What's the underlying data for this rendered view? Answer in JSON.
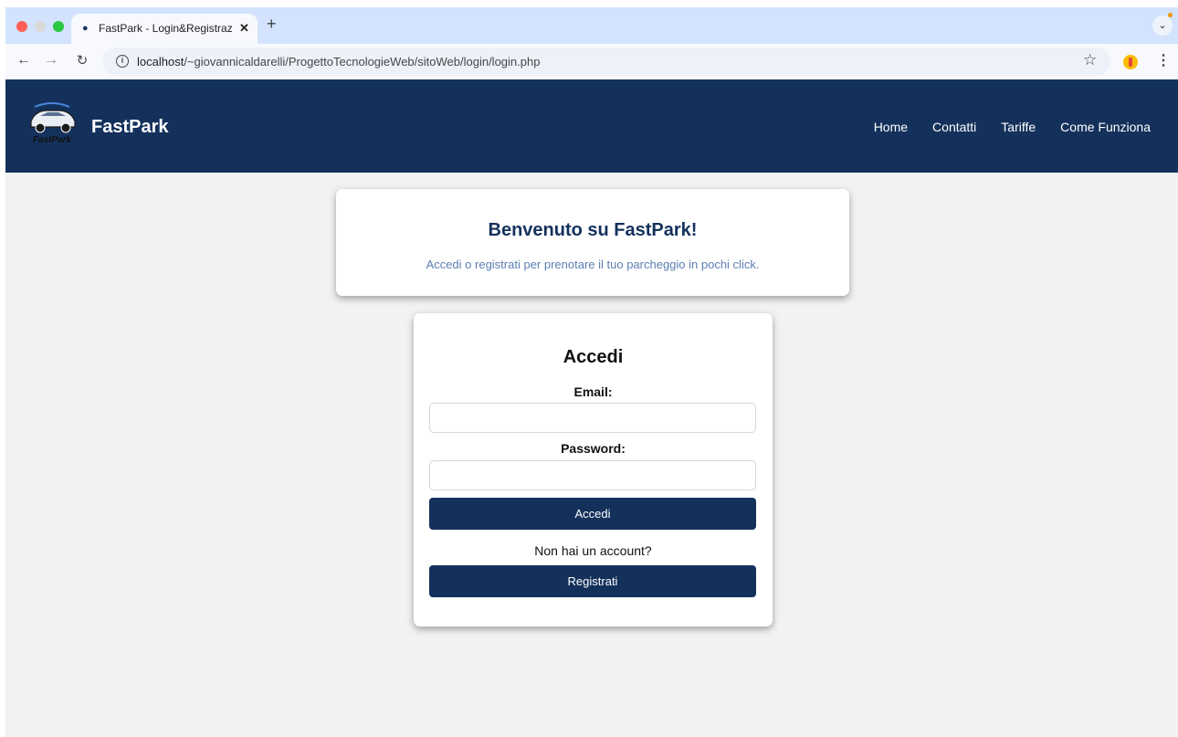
{
  "browser": {
    "tab_title": "FastPark - Login&Registrazione",
    "tab_close": "✕",
    "new_tab": "+",
    "tab_menu": "⌄",
    "url_host": "localhost",
    "url_path": "/~giovannicaldarelli/ProgettoTecnologieWeb/sitoWeb/login/login.php",
    "icons": [
      "back-arrow-icon",
      "forward-arrow-icon",
      "reload-icon",
      "site-info-icon",
      "bookmark-star-icon",
      "extension-icon",
      "kebab-menu-icon"
    ]
  },
  "header": {
    "brand": "FastPark",
    "logo_text": "FastPark",
    "nav": [
      "Home",
      "Contatti",
      "Tariffe",
      "Come Funziona"
    ],
    "background_color": "#14315c"
  },
  "welcome": {
    "title": "Benvenuto su FastPark!",
    "subtitle": "Accedi o registrati per prenotare il tuo parcheggio in pochi click."
  },
  "login": {
    "title": "Accedi",
    "email_label": "Email:",
    "email_value": "",
    "password_label": "Password:",
    "password_value": "",
    "submit_label": "Accedi",
    "no_account_text": "Non hai un account?",
    "register_label": "Registrati"
  }
}
